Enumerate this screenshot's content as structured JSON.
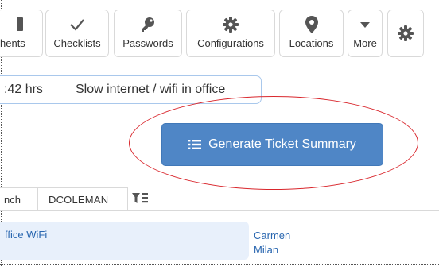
{
  "toolbar": {
    "items": [
      {
        "label": "hents",
        "icon": "attachments-icon"
      },
      {
        "label": "Checklists",
        "icon": "checkmark-icon"
      },
      {
        "label": "Passwords",
        "icon": "key-icon"
      },
      {
        "label": "Configurations",
        "icon": "gear-icon"
      },
      {
        "label": "Locations",
        "icon": "map-pin-icon"
      },
      {
        "label": "More",
        "icon": "caret-down-icon"
      }
    ],
    "settings_icon": "settings-gear-icon"
  },
  "ticket_field": {
    "hours": ":42 hrs",
    "issue": "Slow internet / wifi in office"
  },
  "generate_button": {
    "label": "Generate Ticket Summary",
    "icon": "list-icon"
  },
  "tabs": {
    "items": [
      "nch",
      "DCOLEMAN"
    ],
    "filter_icon": "filter-list-icon"
  },
  "row": {
    "title": "ffice WiFi",
    "assignee_first": "Carmen",
    "assignee_last": "Milan"
  },
  "colors": {
    "button_bg": "#4f86c6",
    "highlight_ellipse": "#d9272d",
    "link": "#2a67b0",
    "row_bg": "#e8f0fb"
  }
}
